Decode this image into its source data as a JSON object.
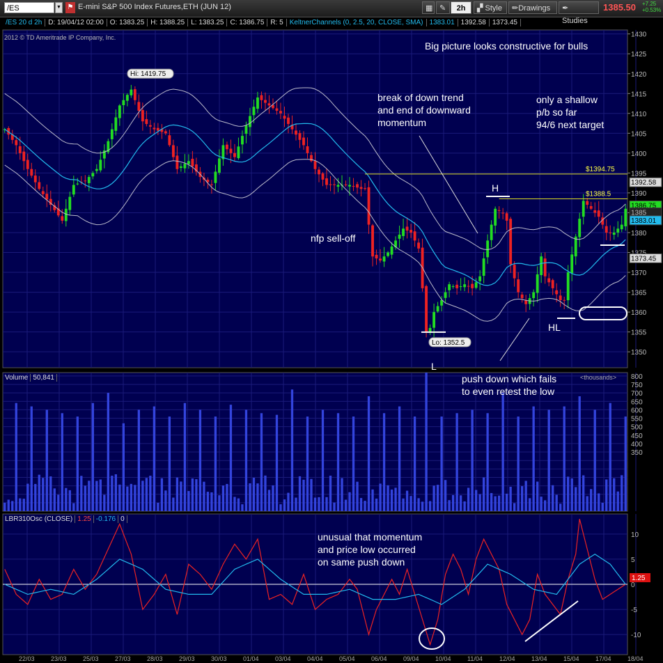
{
  "toolbar": {
    "symbol": "/ES",
    "description": "E-mini S&P 500 Index Futures,ETH (JUN 12)",
    "interval_label": "2h",
    "style_label": "Style",
    "drawings_label": "Drawings",
    "studies_label": "Studies",
    "last_price": "1385.50",
    "net_change": "+7.25",
    "pct_change": "+0.53%"
  },
  "info_bar": {
    "series": "/ES 20 d 2h",
    "date": "D: 19/04/12 02:00",
    "open": "O: 1383.25",
    "high": "H: 1388.25",
    "low": "L: 1383.25",
    "close": "C: 1386.75",
    "range": "R: 5",
    "study": "KeltnerChannels (0, 2.5, 20, CLOSE, SMA)",
    "study_v1": "1383.01",
    "study_v2": "1392.58",
    "study_v3": "1373.45"
  },
  "copyright": "2012 © TD Ameritrade IP Company, Inc.",
  "annotations": {
    "big_picture": "Big picture looks constructive for bulls",
    "break_trend": "break of down trend\nand end of downward\nmomentum",
    "shallow": "only a shallow\np/b so far\n94/6 next target",
    "nfp": "nfp sell-off",
    "h": "H",
    "l": "L",
    "hl": "HL",
    "push_down": "push down which fails\nto even retest the low",
    "unusual": "unusual that momentum\nand price low occurred\non same push down"
  },
  "volume_panel": {
    "label": "Volume",
    "value": "50,841",
    "units": "<thousands>"
  },
  "osc_panel": {
    "label": "LBR310Osc (CLOSE)",
    "v1": "1.25",
    "v2": "-0.176",
    "v3": "0"
  },
  "colors": {
    "bg": "#000050",
    "up": "#22dd22",
    "down": "#ee2222",
    "keltner_mid": "#22bbee",
    "keltner_band": "#bbbbcc",
    "volume": "#3344dd",
    "osc_fast": "#ee2222",
    "osc_slow": "#22bbee",
    "grid": "#1a1a7a"
  },
  "chart_data": [
    {
      "type": "candlestick",
      "title": "/ES 20 d 2h",
      "y_ticks": [
        1350,
        1355,
        1360,
        1365,
        1370,
        1375,
        1380,
        1385,
        1390,
        1395,
        1400,
        1405,
        1410,
        1415,
        1420,
        1425,
        1430
      ],
      "ylim": [
        1346,
        1431
      ],
      "x_labels": [
        "22/03",
        "23/03",
        "25/03",
        "27/03",
        "28/03",
        "29/03",
        "30/03",
        "01/04",
        "03/04",
        "04/04",
        "05/04",
        "06/04",
        "09/04",
        "10/04",
        "11/04",
        "12/04",
        "13/04",
        "15/04",
        "17/04",
        "18/04"
      ],
      "anchors": [
        [
          0,
          1406
        ],
        [
          3,
          1402
        ],
        [
          6,
          1396
        ],
        [
          9,
          1391
        ],
        [
          12,
          1387
        ],
        [
          15,
          1383
        ],
        [
          18,
          1392
        ],
        [
          21,
          1393
        ],
        [
          24,
          1396
        ],
        [
          27,
          1403
        ],
        [
          30,
          1412
        ],
        [
          33,
          1416
        ],
        [
          36,
          1408
        ],
        [
          39,
          1406
        ],
        [
          42,
          1405
        ],
        [
          45,
          1396
        ],
        [
          48,
          1398
        ],
        [
          51,
          1394
        ],
        [
          54,
          1392
        ],
        [
          57,
          1402
        ],
        [
          60,
          1399
        ],
        [
          63,
          1407
        ],
        [
          66,
          1414
        ],
        [
          69,
          1412
        ],
        [
          72,
          1410
        ],
        [
          75,
          1406
        ],
        [
          78,
          1402
        ],
        [
          81,
          1396
        ],
        [
          84,
          1392
        ],
        [
          87,
          1392
        ],
        [
          90,
          1392
        ],
        [
          93,
          1391
        ],
        [
          94,
          1391
        ],
        [
          95,
          1382
        ],
        [
          96,
          1374
        ],
        [
          98,
          1373
        ],
        [
          100,
          1375
        ],
        [
          102,
          1378
        ],
        [
          104,
          1381
        ],
        [
          106,
          1380
        ],
        [
          108,
          1376
        ],
        [
          109,
          1366
        ],
        [
          110,
          1355
        ],
        [
          111,
          1356
        ],
        [
          112,
          1360
        ],
        [
          114,
          1363
        ],
        [
          116,
          1367
        ],
        [
          118,
          1366
        ],
        [
          120,
          1367
        ],
        [
          122,
          1366
        ],
        [
          124,
          1369
        ],
        [
          126,
          1378
        ],
        [
          128,
          1386
        ],
        [
          130,
          1385
        ],
        [
          131,
          1383
        ],
        [
          132,
          1372
        ],
        [
          134,
          1365
        ],
        [
          136,
          1362
        ],
        [
          138,
          1365
        ],
        [
          140,
          1374
        ],
        [
          141,
          1369
        ],
        [
          143,
          1366
        ],
        [
          145,
          1363
        ],
        [
          146,
          1363
        ],
        [
          147,
          1370
        ],
        [
          149,
          1379
        ],
        [
          151,
          1388
        ],
        [
          153,
          1386
        ],
        [
          155,
          1384
        ],
        [
          157,
          1380
        ],
        [
          159,
          1380
        ],
        [
          161,
          1382
        ],
        [
          162,
          1386
        ]
      ],
      "n_bars": 163,
      "high_label": "Hi: 1419.75",
      "low_label": "Lo: 1352.5",
      "level_lines": [
        {
          "value": 1394.75,
          "label": "$1394.75"
        },
        {
          "value": 1388.5,
          "label": "$1388.5"
        }
      ],
      "price_labels": [
        {
          "value": 1392.58,
          "text": "1392.58",
          "fill": "#dddddd",
          "textColor": "#000000"
        },
        {
          "value": 1386.75,
          "text": "1386.75",
          "fill": "#22dd22",
          "textColor": "#000000"
        },
        {
          "value": 1385.0,
          "text": "1385",
          "fill": "#222222",
          "textColor": "#bbbbbb"
        },
        {
          "value": 1383.01,
          "text": "1383.01",
          "fill": "#22bbee",
          "textColor": "#000000"
        },
        {
          "value": 1373.45,
          "text": "1373.45",
          "fill": "#dddddd",
          "textColor": "#000000"
        }
      ]
    },
    {
      "type": "bar",
      "title": "Volume",
      "y_ticks": [
        50,
        100,
        150,
        200,
        250,
        300,
        350,
        400,
        450,
        500,
        550,
        600,
        650,
        700,
        750,
        800
      ],
      "ylim": [
        0,
        820
      ],
      "y_tick_labels": [
        "",
        "",
        "",
        "",
        "",
        "",
        "350",
        "400",
        "450",
        "500",
        "550",
        "600",
        "650",
        "700",
        "750",
        "800"
      ],
      "spikes": [
        [
          3,
          640
        ],
        [
          7,
          620
        ],
        [
          11,
          600
        ],
        [
          15,
          580
        ],
        [
          19,
          560
        ],
        [
          23,
          640
        ],
        [
          27,
          700
        ],
        [
          31,
          520
        ],
        [
          35,
          600
        ],
        [
          39,
          620
        ],
        [
          43,
          560
        ],
        [
          47,
          640
        ],
        [
          51,
          600
        ],
        [
          55,
          560
        ],
        [
          59,
          630
        ],
        [
          63,
          600
        ],
        [
          67,
          580
        ],
        [
          71,
          570
        ],
        [
          75,
          720
        ],
        [
          79,
          560
        ],
        [
          83,
          600
        ],
        [
          87,
          580
        ],
        [
          91,
          560
        ],
        [
          95,
          680
        ],
        [
          99,
          580
        ],
        [
          103,
          620
        ],
        [
          107,
          560
        ],
        [
          110,
          820
        ],
        [
          114,
          560
        ],
        [
          118,
          580
        ],
        [
          122,
          600
        ],
        [
          126,
          580
        ],
        [
          130,
          700
        ],
        [
          134,
          560
        ],
        [
          138,
          620
        ],
        [
          142,
          600
        ],
        [
          146,
          620
        ],
        [
          150,
          680
        ],
        [
          154,
          600
        ],
        [
          158,
          640
        ],
        [
          162,
          560
        ]
      ]
    },
    {
      "type": "line",
      "title": "LBR310Osc (CLOSE)",
      "y_ticks": [
        -10,
        -5,
        0,
        5,
        10
      ],
      "ylim": [
        -14,
        14
      ],
      "fast_anchors": [
        [
          0,
          3
        ],
        [
          3,
          -2
        ],
        [
          6,
          -4
        ],
        [
          9,
          1
        ],
        [
          12,
          -3
        ],
        [
          15,
          -2
        ],
        [
          18,
          3
        ],
        [
          21,
          -1
        ],
        [
          24,
          2
        ],
        [
          27,
          7
        ],
        [
          30,
          12
        ],
        [
          33,
          6
        ],
        [
          36,
          -5
        ],
        [
          39,
          -2
        ],
        [
          42,
          2
        ],
        [
          45,
          -6
        ],
        [
          48,
          4
        ],
        [
          51,
          2
        ],
        [
          54,
          -1
        ],
        [
          57,
          4
        ],
        [
          60,
          8
        ],
        [
          63,
          5
        ],
        [
          66,
          9
        ],
        [
          69,
          -3
        ],
        [
          72,
          -2
        ],
        [
          75,
          -4
        ],
        [
          78,
          2
        ],
        [
          81,
          -5
        ],
        [
          84,
          -3
        ],
        [
          87,
          -2
        ],
        [
          90,
          1
        ],
        [
          92,
          -1
        ],
        [
          95,
          -10
        ],
        [
          97,
          -5
        ],
        [
          99,
          -2
        ],
        [
          101,
          1
        ],
        [
          103,
          -2
        ],
        [
          105,
          3
        ],
        [
          107,
          -2
        ],
        [
          109,
          -7
        ],
        [
          111,
          -12
        ],
        [
          113,
          -7
        ],
        [
          115,
          2
        ],
        [
          117,
          6
        ],
        [
          119,
          3
        ],
        [
          121,
          -2
        ],
        [
          123,
          5
        ],
        [
          125,
          9
        ],
        [
          127,
          6
        ],
        [
          129,
          3
        ],
        [
          131,
          -4
        ],
        [
          133,
          -7
        ],
        [
          135,
          -10
        ],
        [
          137,
          -7
        ],
        [
          139,
          2
        ],
        [
          141,
          -2
        ],
        [
          143,
          -4
        ],
        [
          145,
          -6
        ],
        [
          147,
          1
        ],
        [
          149,
          6
        ],
        [
          150,
          13
        ],
        [
          152,
          7
        ],
        [
          154,
          1
        ],
        [
          156,
          -3
        ],
        [
          158,
          -2
        ],
        [
          160,
          -1
        ],
        [
          162,
          0
        ]
      ],
      "slow_anchors": [
        [
          0,
          0
        ],
        [
          6,
          -2
        ],
        [
          12,
          -1
        ],
        [
          18,
          -2
        ],
        [
          24,
          1
        ],
        [
          30,
          5
        ],
        [
          36,
          3
        ],
        [
          42,
          -1
        ],
        [
          48,
          -2
        ],
        [
          54,
          -2
        ],
        [
          60,
          3
        ],
        [
          66,
          5
        ],
        [
          72,
          1
        ],
        [
          78,
          -2
        ],
        [
          84,
          -2
        ],
        [
          90,
          -1
        ],
        [
          96,
          -3
        ],
        [
          102,
          -3
        ],
        [
          108,
          -2
        ],
        [
          114,
          -4
        ],
        [
          120,
          -1
        ],
        [
          126,
          4
        ],
        [
          132,
          2
        ],
        [
          138,
          -1
        ],
        [
          144,
          -2
        ],
        [
          150,
          4
        ],
        [
          154,
          6
        ],
        [
          158,
          4
        ],
        [
          162,
          0
        ]
      ],
      "fast_label": "1.25"
    }
  ]
}
